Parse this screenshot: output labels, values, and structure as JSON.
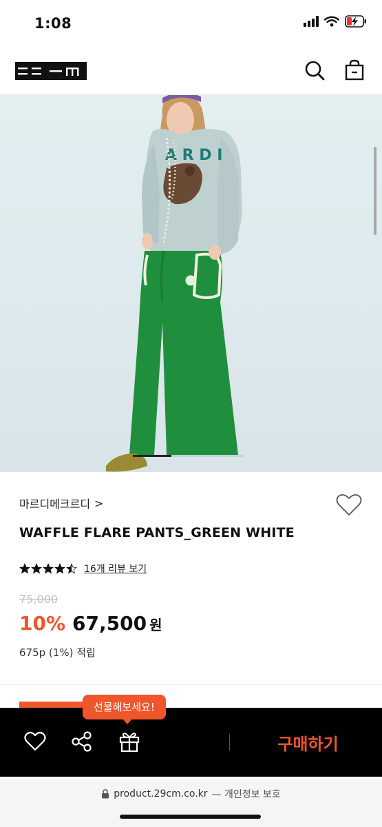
{
  "status_bar": {
    "time": "1:08"
  },
  "header": {
    "logo_text": "29CM"
  },
  "brand": {
    "name": "마르디메크르디",
    "chevron": ">"
  },
  "product": {
    "title": "WAFFLE FLARE PANTS_GREEN WHITE",
    "rating": 4.5,
    "review_link": "16개 리뷰 보기",
    "original_price": "75,000",
    "discount": "10%",
    "sale_price": "67,500",
    "currency": "원",
    "points": "675p (1%) 적립"
  },
  "gallery": {
    "progress": 0.35
  },
  "gift_tooltip": "선물해보세요!",
  "bottom_bar": {
    "buy_label": "구매하기"
  },
  "browser": {
    "url": "product.29cm.co.kr",
    "privacy": "— 개인정보 보호"
  },
  "colors": {
    "accent": "#f0562b",
    "pants_green": "#1f8f3d"
  }
}
